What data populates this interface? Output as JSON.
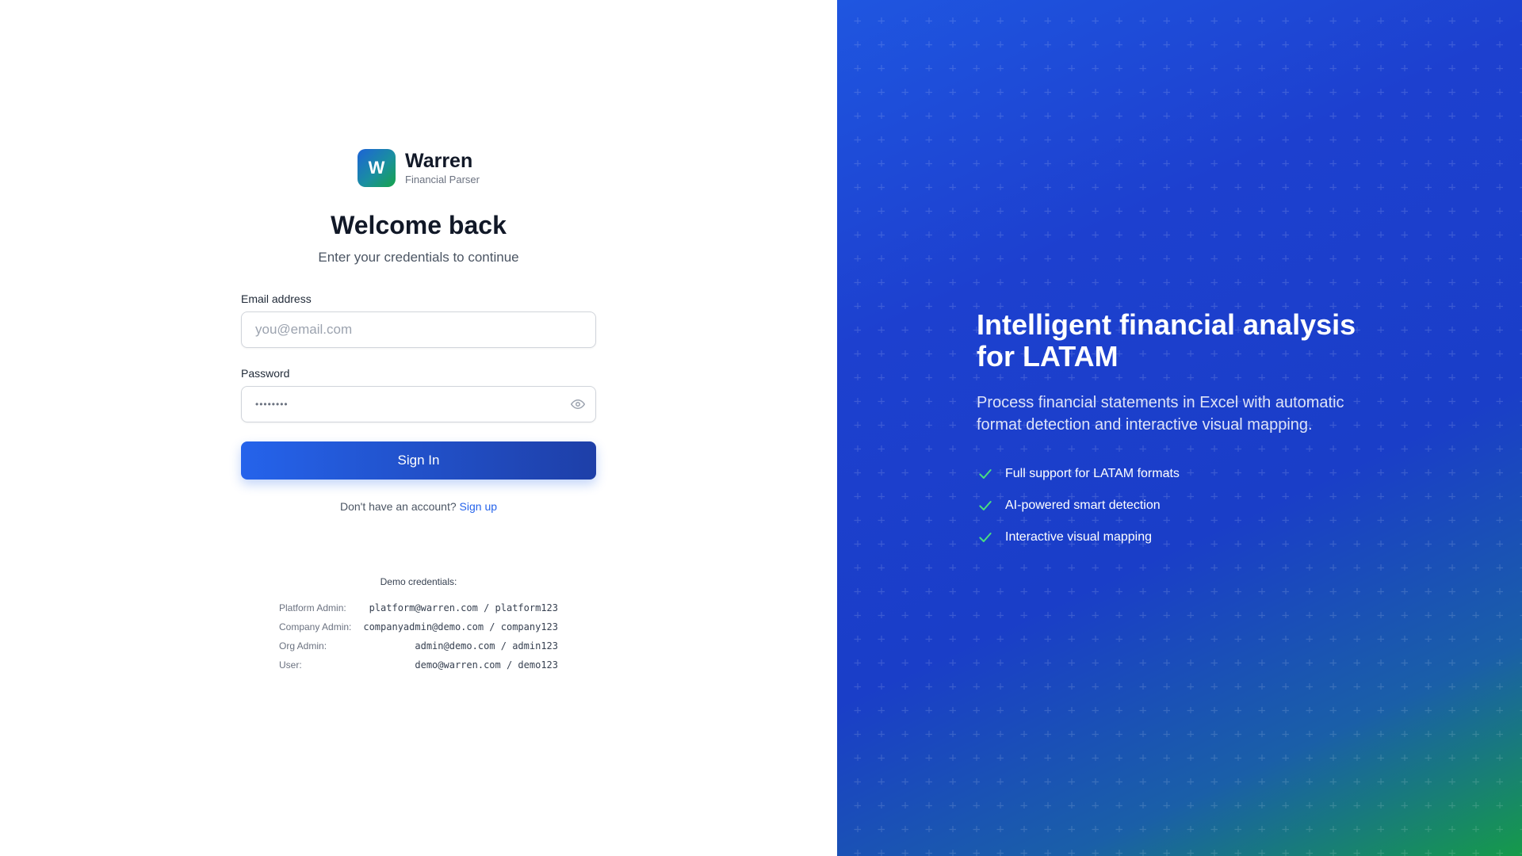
{
  "brand": {
    "logo_letter": "W",
    "name": "Warren",
    "tagline": "Financial Parser"
  },
  "login": {
    "title": "Welcome back",
    "subtitle": "Enter your credentials to continue",
    "email_label": "Email address",
    "email_placeholder": "you@email.com",
    "email_value": "",
    "password_label": "Password",
    "password_mask": "••••••••",
    "signin_label": "Sign In",
    "signup_prompt": "Don't have an account?",
    "signup_link": "Sign up"
  },
  "demo": {
    "title": "Demo credentials:",
    "rows": [
      {
        "role": "Platform Admin:",
        "cred": "platform@warren.com / platform123"
      },
      {
        "role": "Company Admin:",
        "cred": "companyadmin@demo.com / company123"
      },
      {
        "role": "Org Admin:",
        "cred": "admin@demo.com / admin123"
      },
      {
        "role": "User:",
        "cred": "demo@warren.com / demo123"
      }
    ]
  },
  "marketing": {
    "headline": "Intelligent financial analysis for LATAM",
    "description": "Process financial statements in Excel with automatic format detection and interactive visual mapping.",
    "features": [
      "Full support for LATAM formats",
      "AI-powered smart detection",
      "Interactive visual mapping"
    ]
  },
  "colors": {
    "primary": "#2563eb",
    "primary_dark": "#1e3fa8",
    "check_green": "#4ade80"
  },
  "icons": {
    "password_toggle": "eye-icon",
    "feature_bullet": "check-icon"
  }
}
